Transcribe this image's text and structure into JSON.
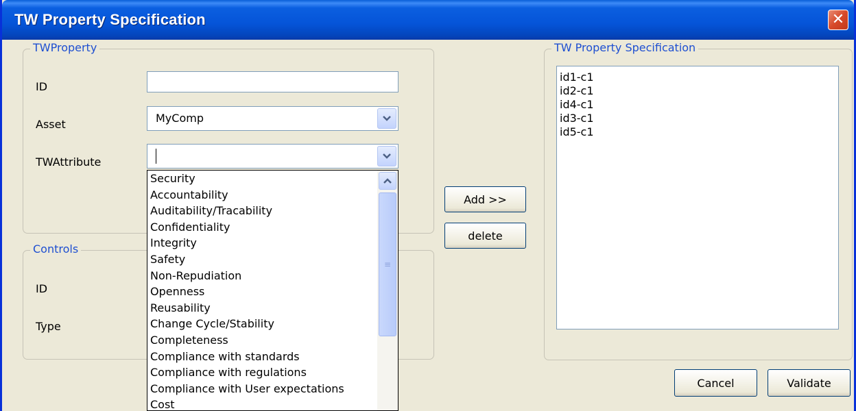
{
  "window": {
    "title": "TW Property Specification",
    "close_glyph": "✕"
  },
  "twproperty": {
    "legend": "TWProperty",
    "id_label": "ID",
    "id_value": "",
    "asset_label": "Asset",
    "asset_value": "MyComp",
    "twattribute_label": "TWAttribute",
    "twattribute_value": ""
  },
  "controls": {
    "legend": "Controls",
    "id_label": "ID",
    "type_label": "Type"
  },
  "dropdown": {
    "items": [
      "Security",
      "Accountability",
      "Auditability/Tracability",
      "Confidentiality",
      "Integrity",
      "Safety",
      "Non-Repudiation",
      "Openness",
      "Reusability",
      "Change Cycle/Stability",
      "Completeness",
      "Compliance with standards",
      "Compliance with regulations",
      "Compliance with User expectations",
      "Cost"
    ]
  },
  "actions": {
    "add_label": "Add >>",
    "delete_label": "delete"
  },
  "spec": {
    "legend": "TW Property Specification",
    "items": [
      "id1-c1",
      "id2-c1",
      "id4-c1",
      "id3-c1",
      "id5-c1"
    ]
  },
  "footer": {
    "cancel_label": "Cancel",
    "validate_label": "Validate"
  },
  "icons": {
    "chevron": "chevron-down-icon",
    "up": "chevron-up-icon",
    "close": "close-icon"
  },
  "colors": {
    "titlebar": "#0554d8",
    "legend": "#1e4fd1",
    "window_bg": "#ece9d8"
  }
}
